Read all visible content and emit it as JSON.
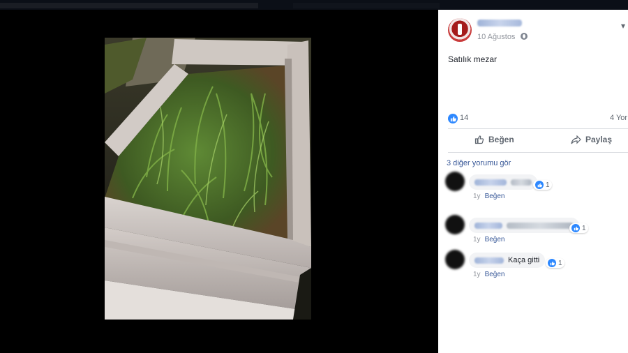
{
  "post": {
    "date": "10 Ağustos",
    "text": "Satılık mezar",
    "like_count": "14",
    "shares_label": "4 Yor",
    "actions": {
      "like": "Beğen",
      "share": "Paylaş"
    },
    "more_comments": "3 diğer yorumu gör"
  },
  "comments": [
    {
      "text": "",
      "reactions": "1",
      "age": "1y",
      "like": "Beğen"
    },
    {
      "text": "",
      "reactions": "1",
      "age": "1y",
      "like": "Beğen"
    },
    {
      "text": "Kaça gitti",
      "reactions": "1",
      "age": "1y",
      "like": "Beğen"
    }
  ],
  "icons": {
    "globe": "globe-icon",
    "like": "thumbs-up-icon",
    "share": "share-arrow-icon",
    "more": "more-options-icon"
  },
  "colors": {
    "accent": "#2d88ff",
    "link": "#385898",
    "background": "#000000"
  }
}
